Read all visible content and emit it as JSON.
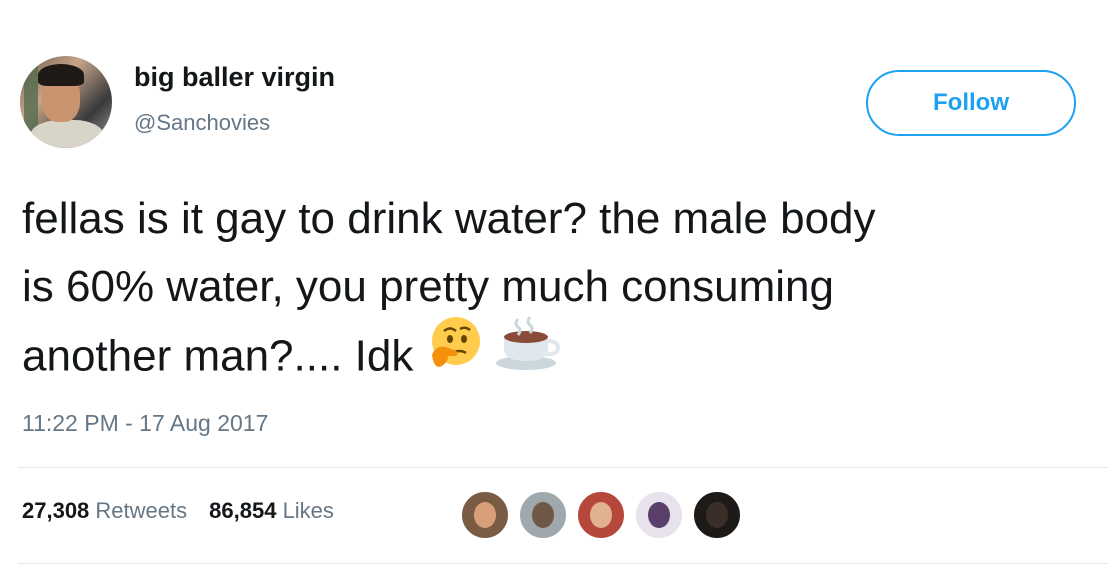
{
  "user": {
    "display_name": "big baller virgin",
    "handle": "@Sanchovies"
  },
  "follow_button": {
    "label": "Follow"
  },
  "tweet": {
    "lines": [
      "fellas is it gay to drink water? the male body",
      "is 60% water, you pretty much consuming",
      "another man?.... Idk"
    ],
    "emojis": [
      "thinking-face-emoji",
      "hot-beverage-emoji"
    ],
    "timestamp": "11:22 PM - 17 Aug 2017"
  },
  "stats": {
    "retweets_count": "27,308",
    "retweets_label": "Retweets",
    "likes_count": "86,854",
    "likes_label": "Likes"
  },
  "likers": [
    {
      "name": "liker-avatar-1",
      "bg": "#7a5c45",
      "face": "#d8a07a"
    },
    {
      "name": "liker-avatar-2",
      "bg": "#9fa8ad",
      "face": "#6e5848"
    },
    {
      "name": "liker-avatar-3",
      "bg": "#b5483a",
      "face": "#e0b38e"
    },
    {
      "name": "liker-avatar-4",
      "bg": "#e8e2ec",
      "face": "#5a3f6a"
    },
    {
      "name": "liker-avatar-5",
      "bg": "#1e1a18",
      "face": "#3a2e28"
    }
  ],
  "colors": {
    "accent": "#1da1f2",
    "text": "#14171a",
    "muted": "#657786",
    "divider": "#e1e8ed"
  }
}
